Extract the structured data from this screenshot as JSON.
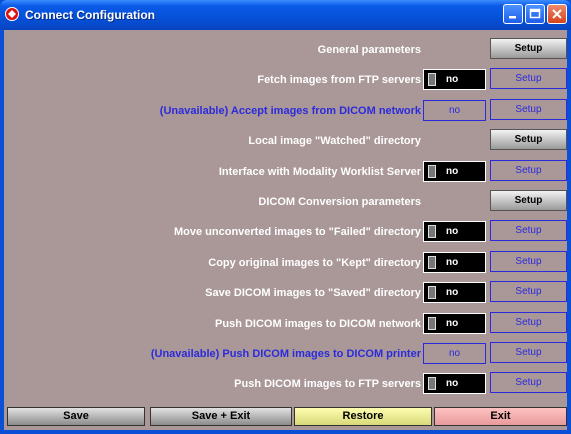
{
  "window": {
    "title": "Connect Configuration"
  },
  "rows": [
    {
      "label": "General parameters",
      "label_unavailable": false,
      "toggle": null,
      "setup": {
        "label": "Setup",
        "active": true
      }
    },
    {
      "label": "Fetch images from FTP servers",
      "label_unavailable": false,
      "toggle": {
        "value": "no",
        "available": true
      },
      "setup": {
        "label": "Setup",
        "active": false
      }
    },
    {
      "label": "(Unavailable) Accept images from DICOM network",
      "label_unavailable": true,
      "toggle": {
        "value": "no",
        "available": false
      },
      "setup": {
        "label": "Setup",
        "active": false
      }
    },
    {
      "label": "Local image \"Watched\" directory",
      "label_unavailable": false,
      "toggle": null,
      "setup": {
        "label": "Setup",
        "active": true
      }
    },
    {
      "label": "Interface with Modality Worklist Server",
      "label_unavailable": false,
      "toggle": {
        "value": "no",
        "available": true
      },
      "setup": {
        "label": "Setup",
        "active": false
      }
    },
    {
      "label": "DICOM Conversion parameters",
      "label_unavailable": false,
      "toggle": null,
      "setup": {
        "label": "Setup",
        "active": true
      }
    },
    {
      "label": "Move unconverted images to \"Failed\" directory",
      "label_unavailable": false,
      "toggle": {
        "value": "no",
        "available": true
      },
      "setup": {
        "label": "Setup",
        "active": false
      }
    },
    {
      "label": "Copy original images to \"Kept\" directory",
      "label_unavailable": false,
      "toggle": {
        "value": "no",
        "available": true
      },
      "setup": {
        "label": "Setup",
        "active": false
      }
    },
    {
      "label": "Save DICOM images to \"Saved\" directory",
      "label_unavailable": false,
      "toggle": {
        "value": "no",
        "available": true
      },
      "setup": {
        "label": "Setup",
        "active": false
      }
    },
    {
      "label": "Push DICOM images to DICOM network",
      "label_unavailable": false,
      "toggle": {
        "value": "no",
        "available": true
      },
      "setup": {
        "label": "Setup",
        "active": false
      }
    },
    {
      "label": "(Unavailable) Push DICOM images to DICOM printer",
      "label_unavailable": true,
      "toggle": {
        "value": "no",
        "available": false
      },
      "setup": {
        "label": "Setup",
        "active": false
      }
    },
    {
      "label": "Push DICOM images to FTP servers",
      "label_unavailable": false,
      "toggle": {
        "value": "no",
        "available": true
      },
      "setup": {
        "label": "Setup",
        "active": false
      }
    }
  ],
  "buttons": {
    "save": "Save",
    "save_exit": "Save + Exit",
    "restore": "Restore",
    "exit": "Exit"
  },
  "colors": {
    "panel": "#aa9797",
    "unavailable": "#2b2bdc",
    "restore": "#f2f29a",
    "exit": "#f0a8a8"
  }
}
